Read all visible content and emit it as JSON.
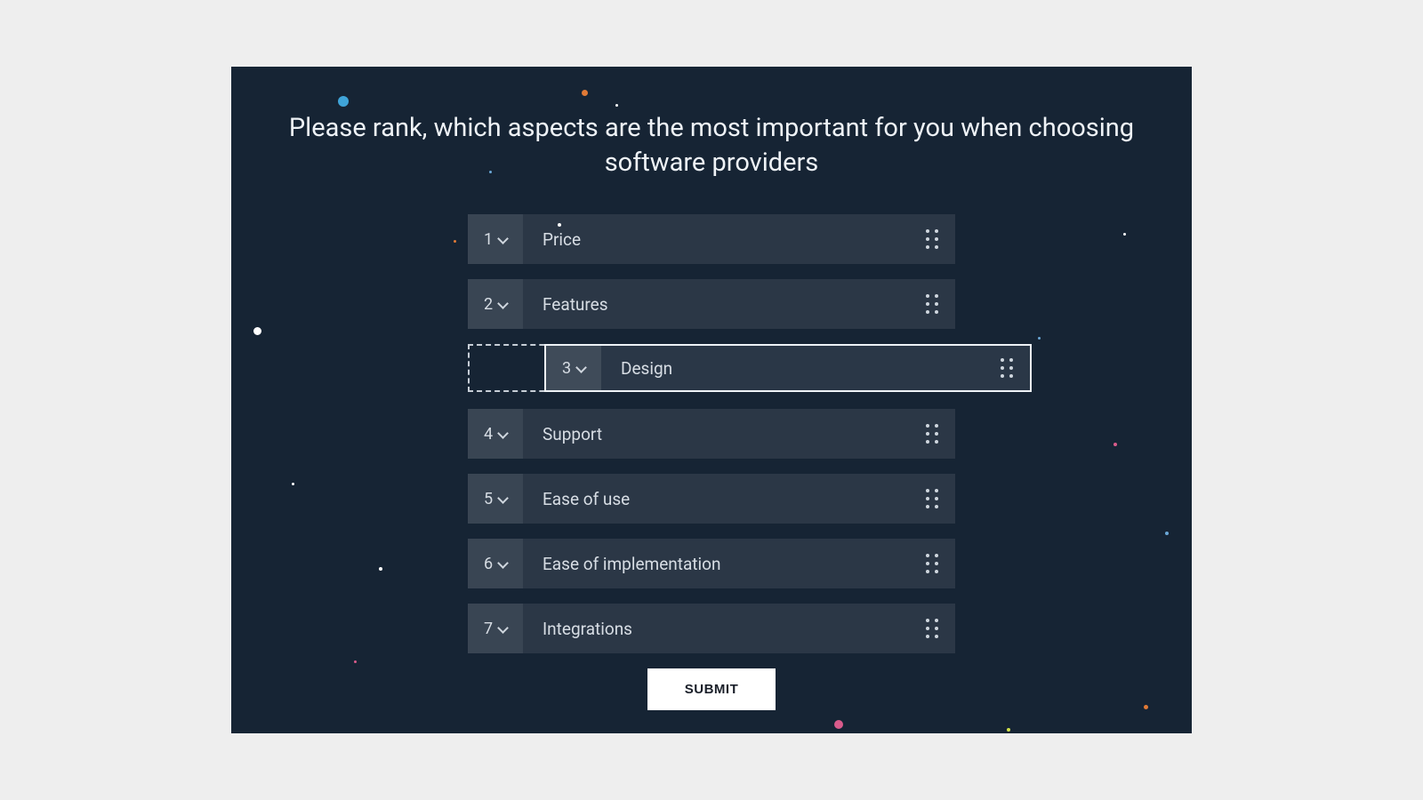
{
  "question": "Please rank, which aspects are the most important for you when choosing software providers",
  "items": [
    {
      "rank": "1",
      "label": "Price",
      "dragging": false
    },
    {
      "rank": "2",
      "label": "Features",
      "dragging": false
    },
    {
      "rank": "3",
      "label": "Design",
      "dragging": true
    },
    {
      "rank": "4",
      "label": "Support",
      "dragging": false
    },
    {
      "rank": "5",
      "label": "Ease of use",
      "dragging": false
    },
    {
      "rank": "6",
      "label": "Ease of implementation",
      "dragging": false
    },
    {
      "rank": "7",
      "label": "Integrations",
      "dragging": false
    }
  ],
  "submit_label": "SUBMIT",
  "colors": {
    "bg": "#162434",
    "accent_blue": "#3fa4d8",
    "accent_orange": "#e07a36",
    "accent_pink": "#d95b8b"
  }
}
